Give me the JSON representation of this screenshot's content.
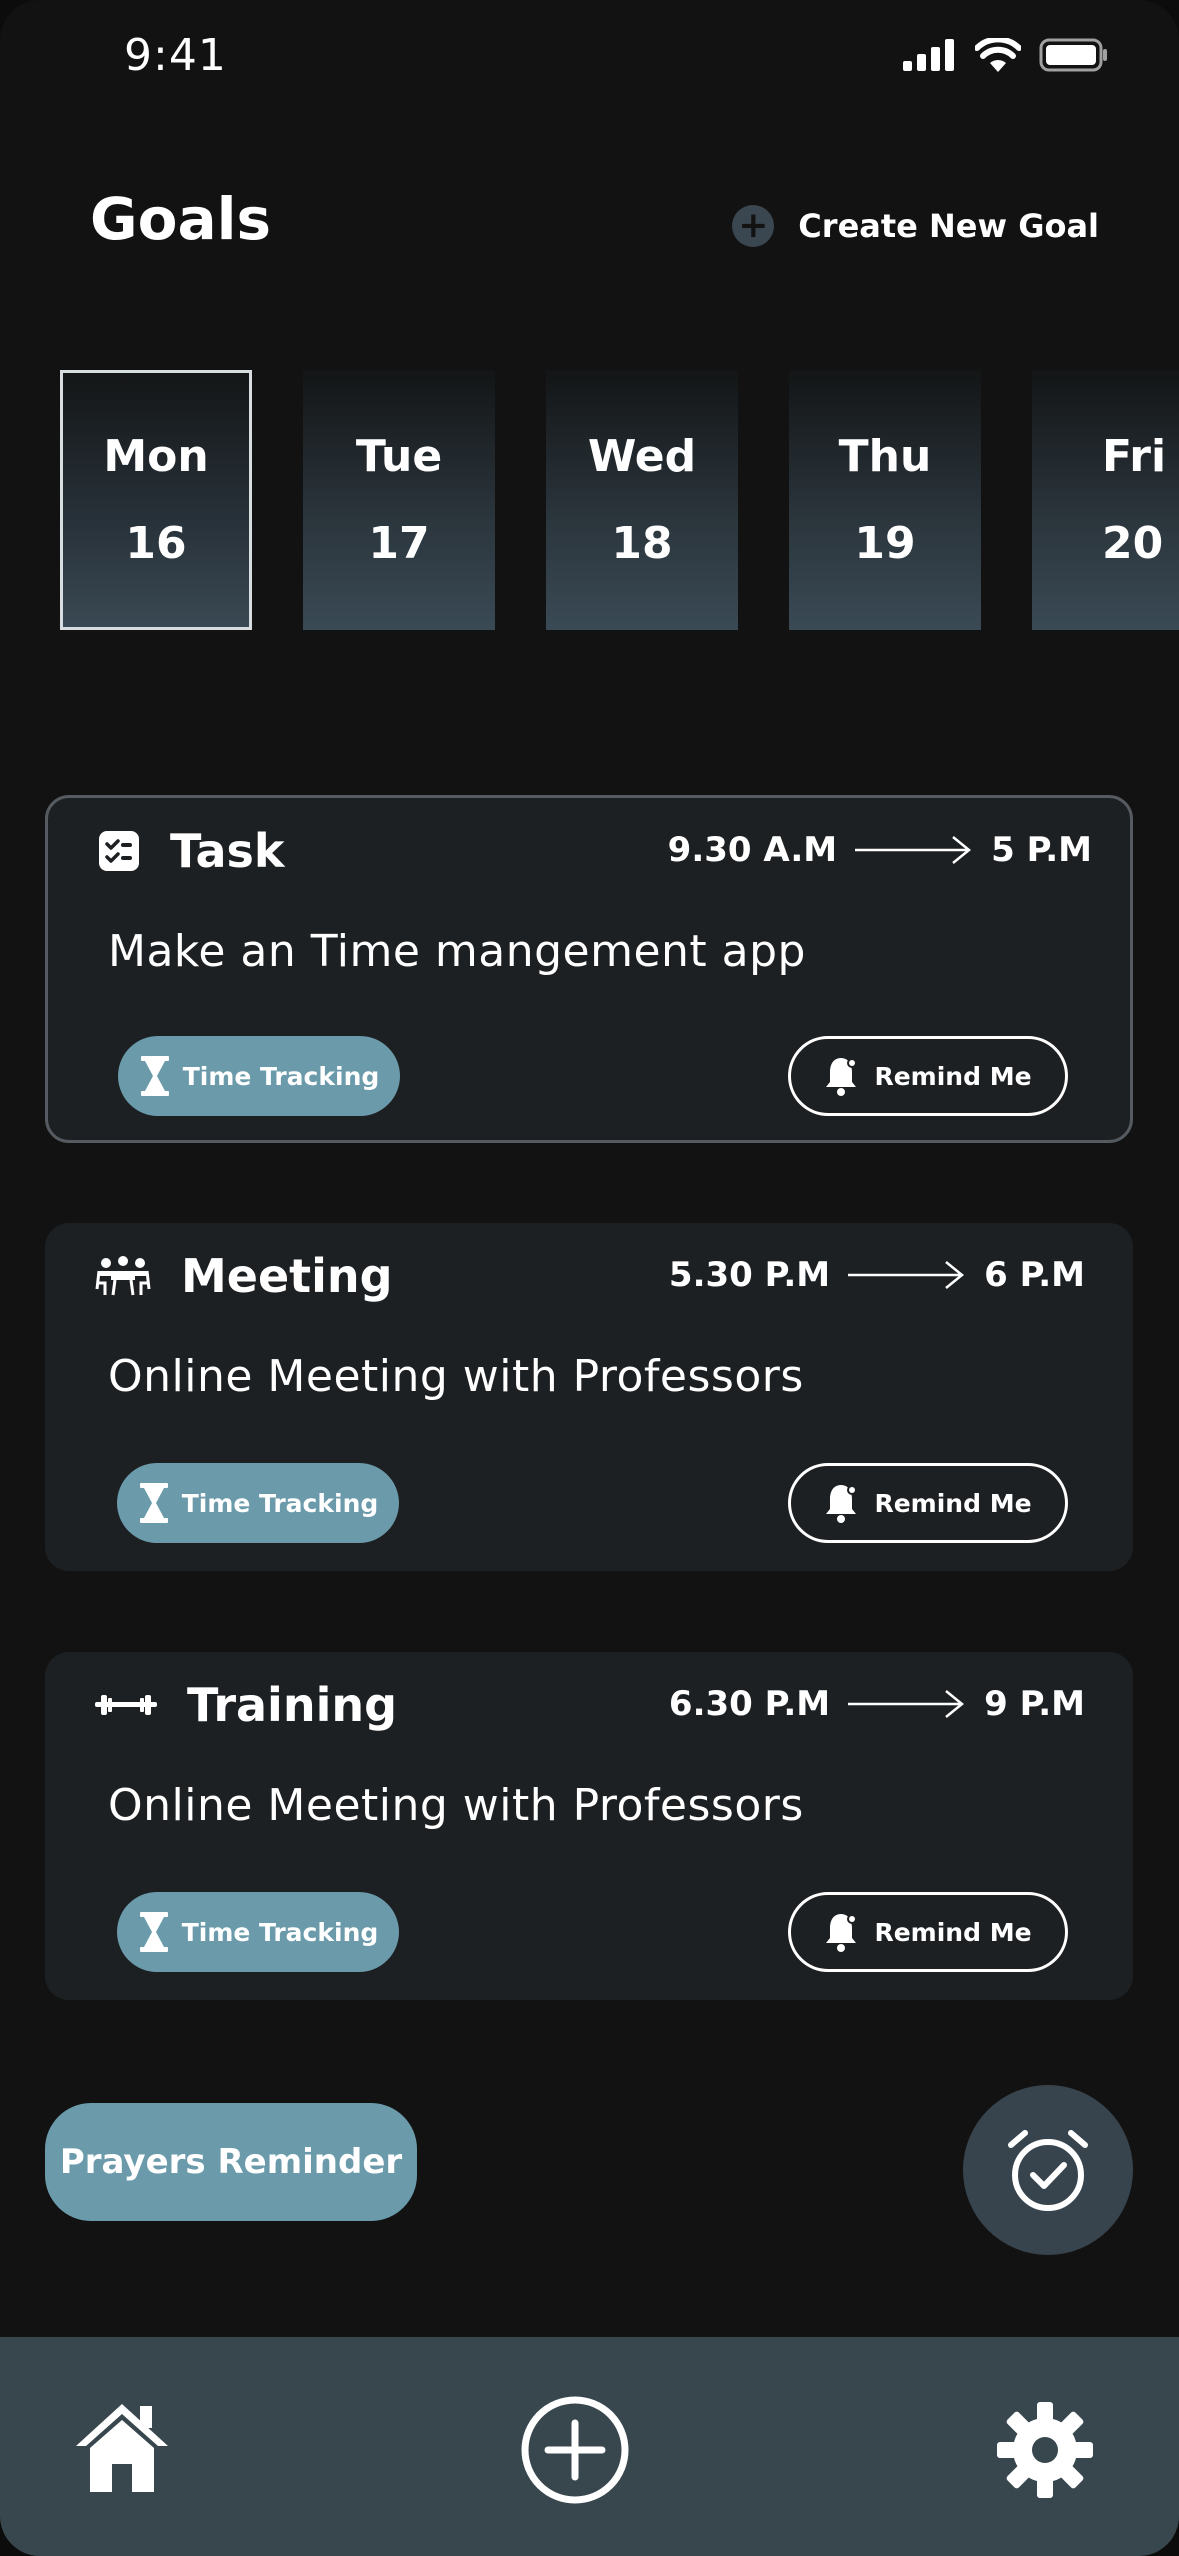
{
  "status_bar": {
    "time": "9:41"
  },
  "header": {
    "title": "Goals",
    "create_label": "Create New Goal"
  },
  "days": [
    {
      "name": "Mon",
      "date": "16",
      "selected": true
    },
    {
      "name": "Tue",
      "date": "17",
      "selected": false
    },
    {
      "name": "Wed",
      "date": "18",
      "selected": false
    },
    {
      "name": "Thu",
      "date": "19",
      "selected": false
    },
    {
      "name": "Fri",
      "date": "20",
      "selected": false
    }
  ],
  "goals": [
    {
      "type": "Task",
      "icon": "checklist-icon",
      "start": "9.30 A.M",
      "end": "5 P.M",
      "description": "Make an Time mangement app",
      "track_label": "Time Tracking",
      "remind_label": "Remind Me"
    },
    {
      "type": "Meeting",
      "icon": "meeting-icon",
      "start": "5.30 P.M",
      "end": "6 P.M",
      "description": "Online Meeting with Professors",
      "track_label": "Time Tracking",
      "remind_label": "Remind Me"
    },
    {
      "type": "Training",
      "icon": "dumbbell-icon",
      "start": "6.30 P.M",
      "end": "9 P.M",
      "description": "Online Meeting with Professors",
      "track_label": "Time Tracking",
      "remind_label": "Remind Me"
    }
  ],
  "actions": {
    "prayers_label": "Prayers Reminder",
    "alarm_icon": "alarm-check-icon"
  },
  "tabbar": {
    "home_icon": "home-icon",
    "add_icon": "add-circle-icon",
    "settings_icon": "gear-icon"
  },
  "colors": {
    "background": "#121212",
    "card": "#1d2023",
    "accent": "#6b9bab",
    "tabbar": "#38464e"
  }
}
